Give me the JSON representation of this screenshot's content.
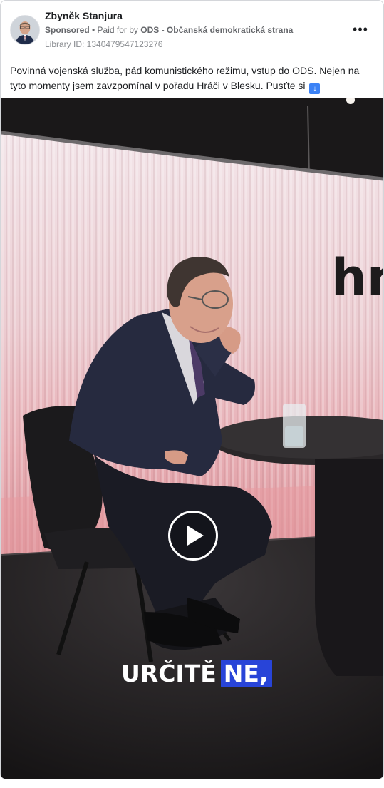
{
  "post": {
    "author": "Zbyněk Stanjura",
    "sponsored_label": "Sponsored",
    "paid_prefix": " • Paid for by ",
    "paid_by": "ODS - Občanská demokratická strana",
    "library_id": "Library ID: 1340479547123276",
    "text": "Povinná vojenská služba, pád komunistického režimu, vstup do ODS. Nejen na tyto momenty jsem zavzpomínal v pořadu Hráči v Blesku. Pusťte si",
    "emoji_label": "↓"
  },
  "video": {
    "caption_plain": "URČITĚ",
    "caption_highlight": "NE,",
    "backdrop_text": "hr",
    "caption_highlight_color": "#2844d8"
  },
  "icons": {
    "more": "more-options-icon",
    "play": "play-icon",
    "emoji": "down-arrow-emoji-icon"
  }
}
